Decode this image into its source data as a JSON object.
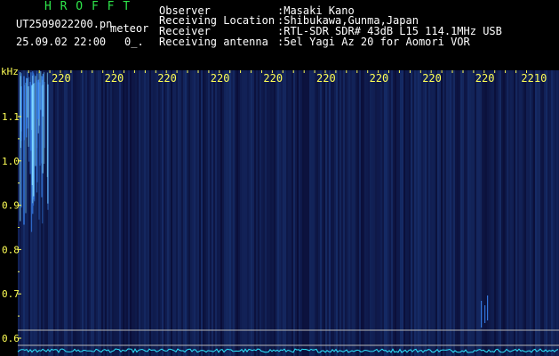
{
  "header": {
    "logo": "H R O F F T",
    "filename": "UT2509022200.pn",
    "mode": "meteor",
    "datetime": "25.09.02 22:00",
    "count": "0_.",
    "info": [
      {
        "label": "Observer",
        "value": ":Masaki Kano"
      },
      {
        "label": "Receiving Location",
        "value": ":Shibukawa,Gunma,Japan"
      },
      {
        "label": "Receiver",
        "value": ":RTL-SDR SDR# 43dB L15 114.1MHz USB"
      },
      {
        "label": "Receiving antenna",
        "value": ":5el Yagi Az 20 for Aomori VOR"
      }
    ]
  },
  "plot": {
    "y_unit": "kHz",
    "y_ticks": [
      "1.1",
      "1.0",
      "0.9",
      "0.8",
      "0.7",
      "0.6"
    ],
    "x_ticks": [
      "220",
      "220",
      "220",
      "220",
      "220",
      "220",
      "220",
      "220",
      "220",
      "2210"
    ],
    "colors": {
      "background": "#08082e",
      "signal": "#3c8cff",
      "tick": "#ffff55",
      "baseline": "#2ee8ff"
    }
  }
}
